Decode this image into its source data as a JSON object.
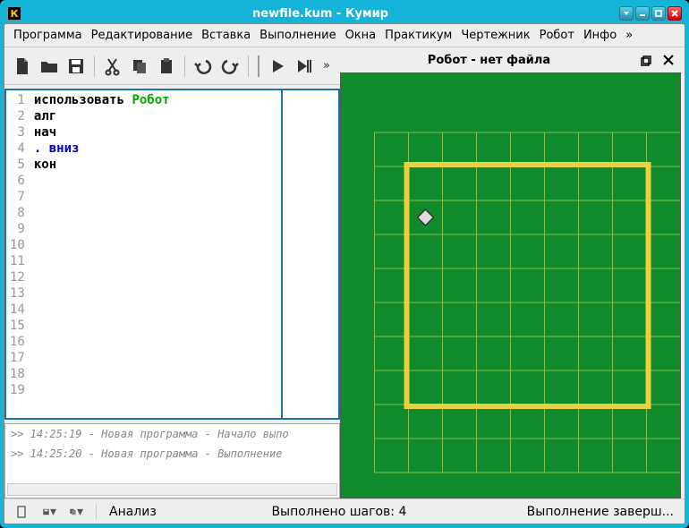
{
  "window": {
    "title": "newfile.kum - Кумир",
    "app_letter": "К"
  },
  "menu": {
    "items": [
      "Программа",
      "Редактирование",
      "Вставка",
      "Выполнение",
      "Окна",
      "Практикум",
      "Чертежник",
      "Робот",
      "Инфо",
      "»"
    ]
  },
  "editor": {
    "lines": [
      {
        "n": 1,
        "segments": [
          {
            "cls": "kw-use",
            "t": "использовать "
          },
          {
            "cls": "kw-mod",
            "t": "Робот"
          }
        ]
      },
      {
        "n": 2,
        "segments": [
          {
            "cls": "kw-alg",
            "t": "алг"
          }
        ]
      },
      {
        "n": 3,
        "segments": [
          {
            "cls": "kw-alg",
            "t": "нач"
          }
        ]
      },
      {
        "n": 4,
        "segments": [
          {
            "cls": "kw-cmd",
            "t": ". вниз"
          }
        ]
      },
      {
        "n": 5,
        "segments": [
          {
            "cls": "kw-alg",
            "t": "кон"
          }
        ]
      }
    ],
    "total_rows": 19
  },
  "log": {
    "entries": [
      ">> 14:25:19 - Новая программа - Начало выпо",
      ">> 14:25:20 - Новая программа - Выполнение"
    ]
  },
  "robot_panel": {
    "title": "Робот - нет файла",
    "grid": {
      "cols": 8,
      "rows": 9,
      "inner_cols": 7,
      "inner_rows": 7
    },
    "robot_pos": {
      "col": 0,
      "row": 1
    }
  },
  "status": {
    "analysis": "Анализ",
    "steps": "Выполнено шагов: 4",
    "state": "Выполнение заверш..."
  }
}
